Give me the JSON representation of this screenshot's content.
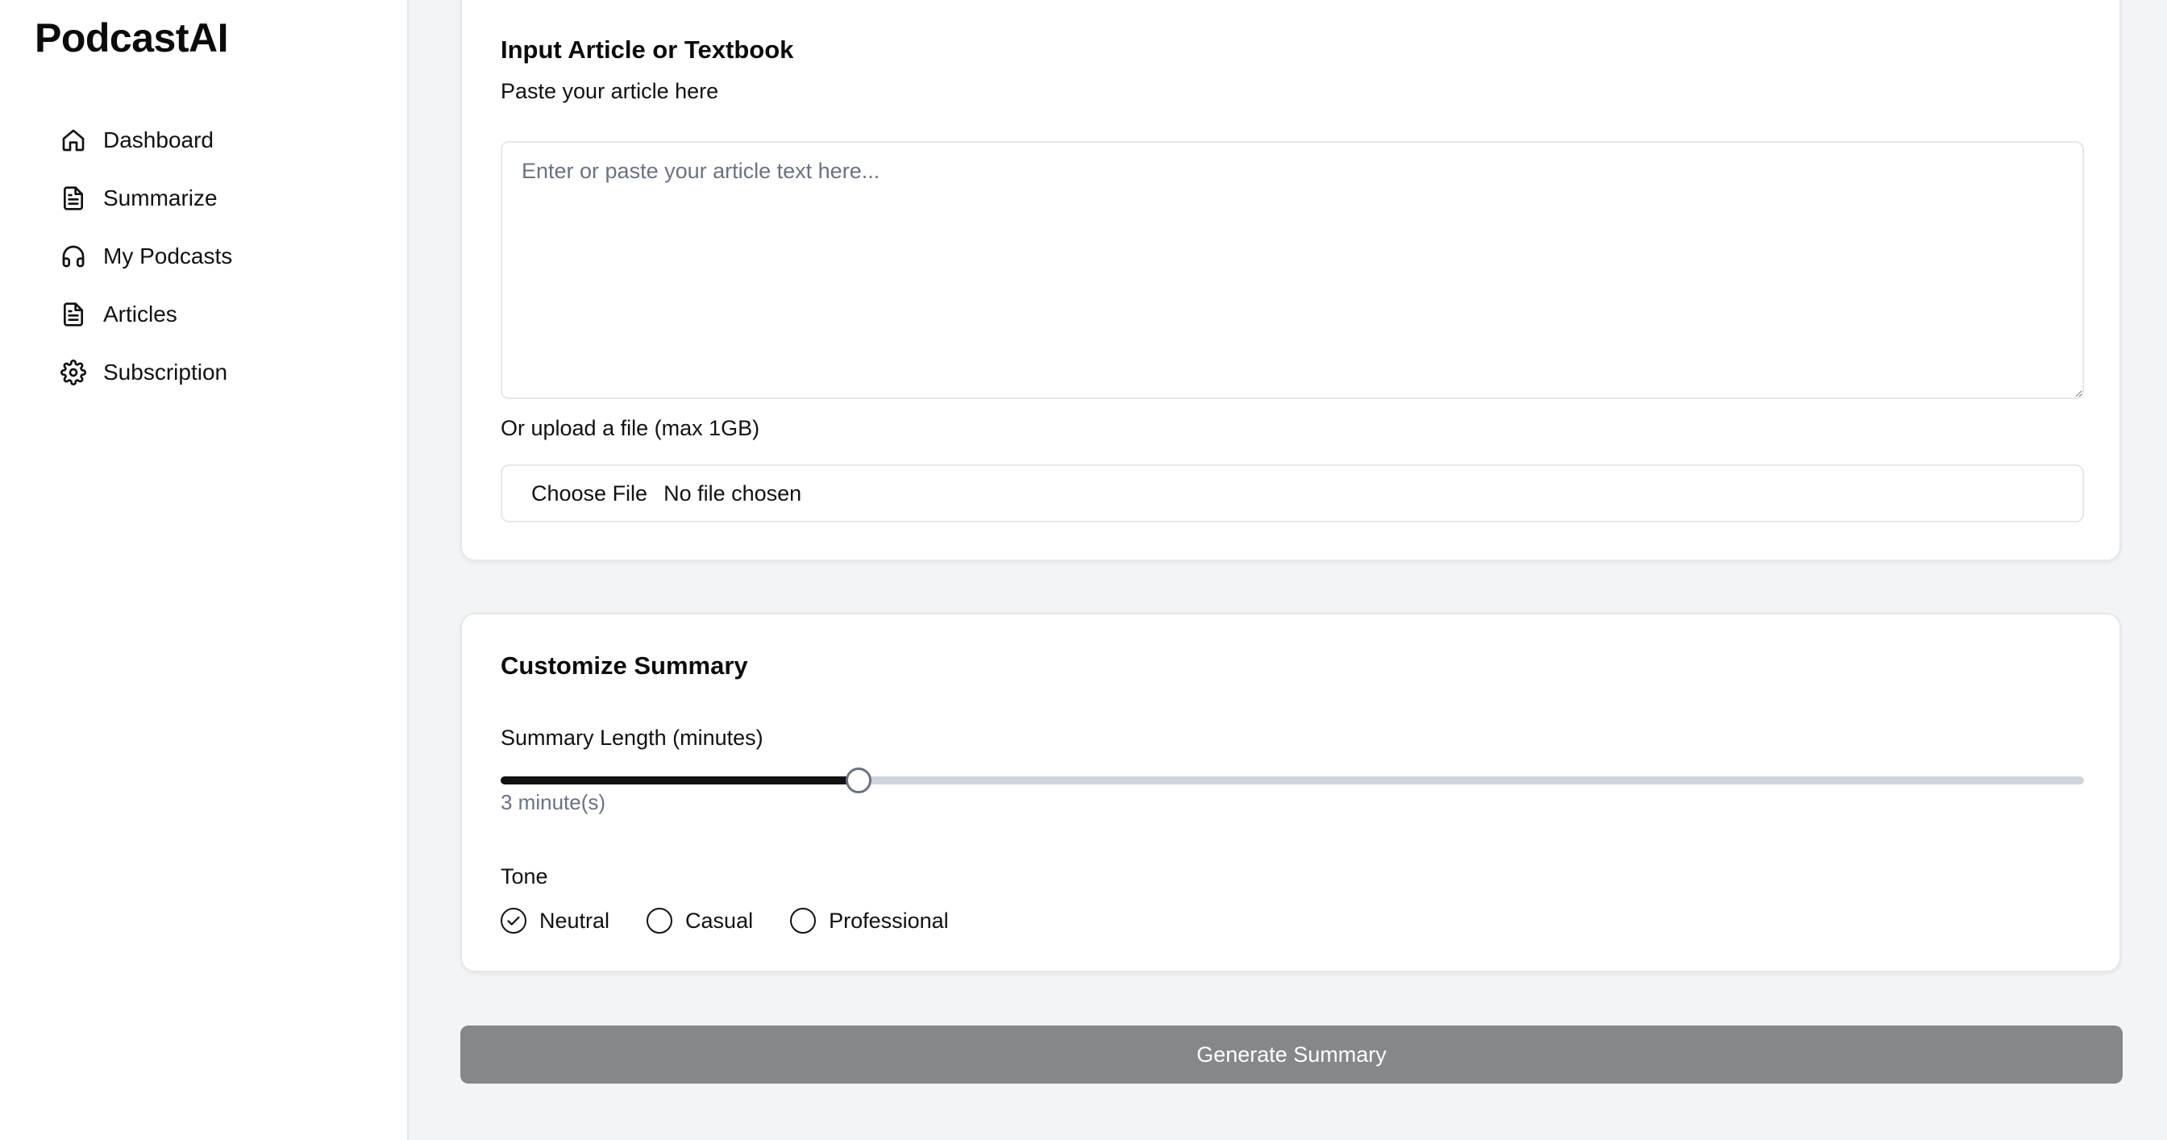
{
  "app": {
    "brand": "PodcastAI"
  },
  "sidebar": {
    "items": [
      {
        "label": "Dashboard",
        "icon": "home-icon"
      },
      {
        "label": "Summarize",
        "icon": "document-icon"
      },
      {
        "label": "My Podcasts",
        "icon": "headphones-icon"
      },
      {
        "label": "Articles",
        "icon": "document-icon"
      },
      {
        "label": "Subscription",
        "icon": "gear-icon"
      }
    ]
  },
  "input_card": {
    "title": "Input Article or Textbook",
    "article_label": "Paste your article here",
    "article_value": "",
    "article_placeholder": "Enter or paste your article text here...",
    "upload_label": "Or upload a file (max 1GB)",
    "choose_file_label": "Choose File",
    "file_status": "No file chosen"
  },
  "customize_card": {
    "title": "Customize Summary",
    "length_label": "Summary Length (minutes)",
    "length_fraction": 0.226,
    "length_value_text": "3 minute(s)",
    "tone_label": "Tone",
    "tone_options": [
      {
        "label": "Neutral",
        "selected": true
      },
      {
        "label": "Casual",
        "selected": false
      },
      {
        "label": "Professional",
        "selected": false
      }
    ]
  },
  "actions": {
    "generate_label": "Generate Summary"
  },
  "colors": {
    "sidebar_bg": "#ffffff",
    "page_bg": "#f3f4f6",
    "button_bg": "#85878a",
    "slider_fill": "#111111",
    "slider_track": "#d1d5db"
  }
}
